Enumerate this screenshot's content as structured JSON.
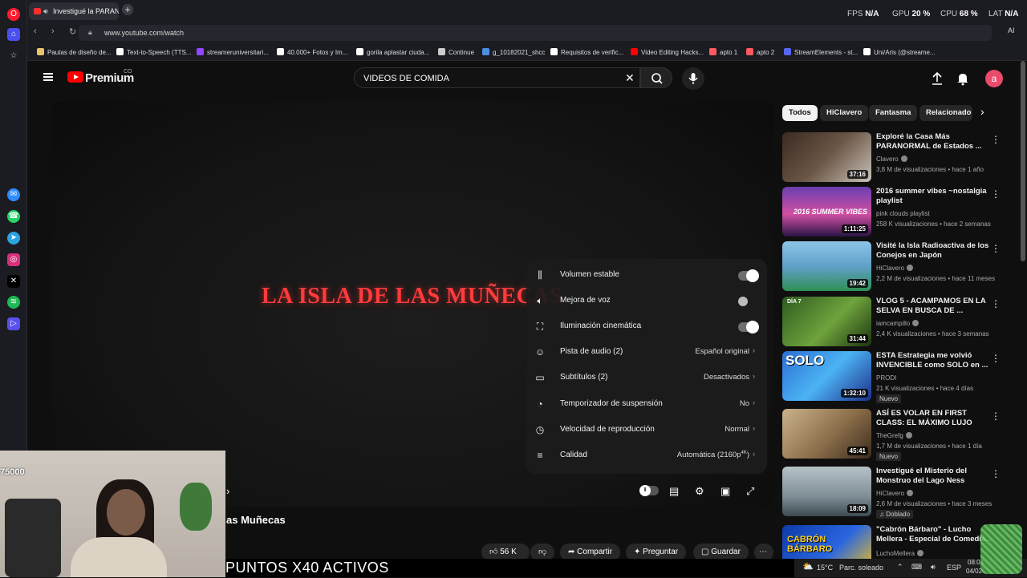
{
  "browser": {
    "tab_title": "Investigué la PARANO",
    "url": "www.youtube.com/watch",
    "stats": {
      "fps_label": "FPS",
      "fps_value": "N/A",
      "gpu_label": "GPU",
      "gpu_value": "20 %",
      "cpu_label": "CPU",
      "cpu_value": "68 %",
      "lat_label": "LAT",
      "lat_value": "N/A"
    },
    "ai_label": "AI",
    "bookmarks": [
      {
        "label": "Pautas de diseño de...",
        "color": "#e9c46a"
      },
      {
        "label": "Text-to-Speech (TTS...",
        "color": "#ffffff"
      },
      {
        "label": "streameruniversitari...",
        "color": "#9146ff"
      },
      {
        "label": "40.000+ Fotos y Im...",
        "color": "#ffffff"
      },
      {
        "label": "gorila aplastar ciuda...",
        "color": "#ffffff"
      },
      {
        "label": "Continue",
        "color": "#cccccc"
      },
      {
        "label": "g_10182021_shcc",
        "color": "#4a90e2"
      },
      {
        "label": "Requisitos de verific...",
        "color": "#ffffff"
      },
      {
        "label": "Video Editing Hacks...",
        "color": "#ff0000"
      },
      {
        "label": "apto 1",
        "color": "#ff5a5f"
      },
      {
        "label": "apto 2",
        "color": "#ff5a5f"
      },
      {
        "label": "StreamElements - st...",
        "color": "#5865f2"
      },
      {
        "label": "Uni/Aris (@streame...",
        "color": "#ffffff"
      }
    ]
  },
  "youtube": {
    "brand": "Premium",
    "country": "CO",
    "search_value": "VIDEOS DE COMIDA",
    "avatar_letter": "a"
  },
  "video": {
    "overlay_title": "LA ISLA DE LAS MUÑECAS",
    "title_partial": "as Muñecas"
  },
  "settings": [
    {
      "label": "Volumen estable",
      "value": "",
      "toggle": "on"
    },
    {
      "label": "Mejora de voz",
      "value": "",
      "toggle": "off"
    },
    {
      "label": "Iluminación cinemática",
      "value": "",
      "toggle": "on"
    },
    {
      "label": "Pista de audio (2)",
      "value": "Español original",
      "toggle": ""
    },
    {
      "label": "Subtítulos (2)",
      "value": "Desactivados",
      "toggle": ""
    },
    {
      "label": "Temporizador de suspensión",
      "value": "No",
      "toggle": ""
    },
    {
      "label": "Velocidad de reproducción",
      "value": "Normal",
      "toggle": ""
    },
    {
      "label": "Calidad",
      "value": "Automática (2160p",
      "sup": "4K",
      "toggle": ""
    }
  ],
  "actions": {
    "likes": "56 K",
    "share": "Compartir",
    "ask": "Preguntar",
    "save": "Guardar"
  },
  "stream": {
    "points_label": "75000",
    "banner": "PUNTOS X40 ACTIVOS"
  },
  "taskbar": {
    "weather": "15°C",
    "weather_desc": "Parc. soleado",
    "lang": "ESP",
    "time": "08:03",
    "date": "04/02"
  },
  "chips": [
    "Todos",
    "HiClavero",
    "Fantasma",
    "Relacionado"
  ],
  "recommendations": [
    {
      "title": "Exploré la Casa Más PARANORMAL de Estados ...",
      "channel": "Clavero",
      "verified": true,
      "meta": "3,8 M de visualizaciones • hace 1 año",
      "duration": "37:16",
      "badge": "",
      "thumb": "linear-gradient(135deg,#3a2a22,#6b5646 50%,#c9c2b8)"
    },
    {
      "title": "2016 summer vibes ~nostalgia playlist",
      "channel": "pink clouds playlist",
      "verified": false,
      "meta": "258 K visualizaciones • hace 2 semanas",
      "duration": "1:11:25",
      "badge": "",
      "thumb": "linear-gradient(180deg,#6a3fb0,#d14fa3 55%,#2a1545)",
      "overlay": "2016 SUMMER VIBES"
    },
    {
      "title": "Visité la Isla Radioactiva de los Conejos en Japón",
      "channel": "HiClavero",
      "verified": true,
      "meta": "2,2 M de visualizaciones • hace 11 meses",
      "duration": "19:42",
      "badge": "",
      "thumb": "linear-gradient(180deg,#8ec5e8,#5fa0c9 50%,#2f8f56)"
    },
    {
      "title": "VLOG 5 - ACAMPAMOS EN LA SELVA EN BUSCA DE ...",
      "channel": "iamcampillo",
      "verified": true,
      "meta": "2,4 K visualizaciones • hace 3 semanas",
      "duration": "31:44",
      "badge": "",
      "thumb": "linear-gradient(135deg,#2e5a1f,#6ea33c 55%,#1c3312)",
      "overlay": "DÍA 7"
    },
    {
      "title": "ESTA Estrategia me volvió INVENCIBLE como SOLO en ...",
      "channel": "PRODI",
      "verified": false,
      "meta": "21 K visualizaciones • hace 4 días",
      "duration": "1:32:10",
      "badge": "Nuevo",
      "thumb": "linear-gradient(135deg,#2b6fd6,#4cb3f2 50%,#1d2f8a)",
      "overlay": "SOLO"
    },
    {
      "title": "ASÍ ES VOLAR EN FIRST CLASS: EL MÁXIMO LUJO",
      "channel": "TheGrefg",
      "verified": true,
      "meta": "1,7 M de visualizaciones • hace 1 día",
      "duration": "45:41",
      "badge": "Nuevo",
      "thumb": "linear-gradient(135deg,#c9b28c,#8b6e4a 55%,#3b2c1d)"
    },
    {
      "title": "Investigué el Misterio del Monstruo del Lago Ness",
      "channel": "HiClavero",
      "verified": true,
      "meta": "2,6 M de visualizaciones • hace 3 meses",
      "duration": "18:09",
      "badge": "Doblado",
      "thumb": "linear-gradient(180deg,#b7c2c8,#7f8e96 60%,#3d4a50)"
    },
    {
      "title": "\"Cabrón Bárbaro\" - Lucho Mellera - Especial de Comedia...",
      "channel": "LuchoMellera",
      "verified": true,
      "meta": "",
      "duration": "",
      "badge": "",
      "thumb": "linear-gradient(135deg,#0d3aa8,#2a66e0 55%,#f3c21b)",
      "overlay": "CABRÓN BÁRBARO"
    }
  ]
}
